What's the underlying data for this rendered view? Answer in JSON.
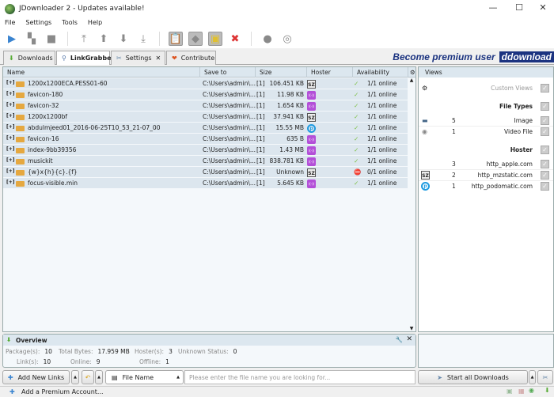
{
  "window": {
    "title": "JDownloader 2 - Updates available!"
  },
  "menu": [
    "File",
    "Settings",
    "Tools",
    "Help"
  ],
  "tabs": [
    {
      "label": "Downloads"
    },
    {
      "label": "LinkGrabber"
    },
    {
      "label": "Settings"
    },
    {
      "label": "Contribute"
    }
  ],
  "premium_banner": {
    "text": "Become premium user",
    "brand": "ddownload"
  },
  "table": {
    "columns": [
      "Name",
      "Save to",
      "Size",
      "Hoster",
      "Availability"
    ],
    "rows": [
      {
        "name": "1200x1200ECA.PESS01-60",
        "save_to": "C:\\Users\\admin\\...",
        "count": "[1]",
        "size": "106.451 KB",
        "hoster": "sz",
        "availability": "1/1 online",
        "ok": true
      },
      {
        "name": "favicon-180",
        "save_to": "C:\\Users\\admin\\...",
        "count": "[1]",
        "size": "11.98 KB",
        "hoster": "pod",
        "availability": "1/1 online",
        "ok": true
      },
      {
        "name": "favicon-32",
        "save_to": "C:\\Users\\admin\\...",
        "count": "[1]",
        "size": "1.654 KB",
        "hoster": "pod",
        "availability": "1/1 online",
        "ok": true
      },
      {
        "name": "1200x1200bf",
        "save_to": "C:\\Users\\admin\\...",
        "count": "[1]",
        "size": "37.941 KB",
        "hoster": "sz",
        "availability": "1/1 online",
        "ok": true
      },
      {
        "name": "abdulmjeed01_2016-06-25T10_53_21-07_00",
        "save_to": "C:\\Users\\admin\\...",
        "count": "[1]",
        "size": "15.55 MB",
        "hoster": "po",
        "availability": "1/1 online",
        "ok": true
      },
      {
        "name": "favicon-16",
        "save_to": "C:\\Users\\admin\\...",
        "count": "[1]",
        "size": "635 B",
        "hoster": "pod",
        "availability": "1/1 online",
        "ok": true
      },
      {
        "name": "index-9bb39356",
        "save_to": "C:\\Users\\admin\\...",
        "count": "[1]",
        "size": "1.43 MB",
        "hoster": "pod",
        "availability": "1/1 online",
        "ok": true
      },
      {
        "name": "musickit",
        "save_to": "C:\\Users\\admin\\...",
        "count": "[1]",
        "size": "838.781 KB",
        "hoster": "pod",
        "availability": "1/1 online",
        "ok": true
      },
      {
        "name": "{w}x{h}{c}.{f}",
        "save_to": "C:\\Users\\admin\\...",
        "count": "[1]",
        "size": "Unknown",
        "hoster": "sz",
        "availability": "0/1 online",
        "ok": false
      },
      {
        "name": "focus-visible.min",
        "save_to": "C:\\Users\\admin\\...",
        "count": "[1]",
        "size": "5.645 KB",
        "hoster": "pod",
        "availability": "1/1 online",
        "ok": true
      }
    ]
  },
  "views": {
    "title": "Views",
    "custom_views": "Custom Views",
    "file_types_label": "File Types",
    "file_types": [
      {
        "count": "5",
        "label": "Image"
      },
      {
        "count": "1",
        "label": "Video File"
      }
    ],
    "hoster_label": "Hoster",
    "hosters": [
      {
        "count": "3",
        "label": "http_apple.com"
      },
      {
        "count": "2",
        "label": "http_mzstatic.com"
      },
      {
        "count": "1",
        "label": "http_podomatic.com"
      }
    ]
  },
  "overview": {
    "title": "Overview",
    "packages_label": "Package(s):",
    "packages": "10",
    "total_bytes_label": "Total Bytes:",
    "total_bytes": "17.959 MB",
    "hosters_label": "Hoster(s):",
    "hosters": "3",
    "unknown_label": "Unknown Status:",
    "unknown": "0",
    "links_label": "Link(s):",
    "links": "10",
    "online_label": "Online:",
    "online": "9",
    "offline_label": "Offline:",
    "offline": "1"
  },
  "bottom": {
    "add_links": "Add New Links",
    "search_field": "File Name",
    "search_placeholder": "Please enter the file name you are looking for...",
    "start_all": "Start all Downloads"
  },
  "status": {
    "add_premium": "Add a Premium Account..."
  }
}
